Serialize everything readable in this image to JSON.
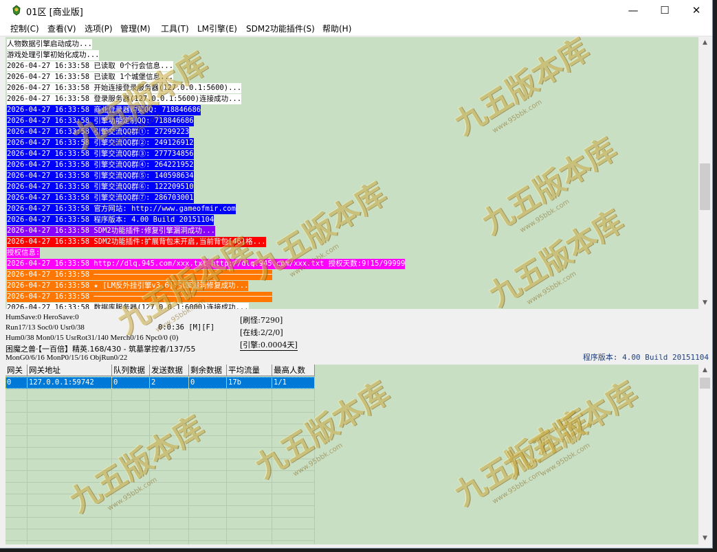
{
  "window": {
    "title": "01区 [商业版]",
    "minimize": "—",
    "maximize": "☐",
    "close": "✕"
  },
  "menu": [
    "控制(C)",
    "查看(V)",
    "选项(P)",
    "管理(M)",
    "工具(T)",
    "LM引擎(E)",
    "SDM2功能插件(S)",
    "帮助(H)"
  ],
  "log_lines": [
    {
      "text": "人物数据引擎启动成功...",
      "bg": "#ffffff",
      "fg": "#000000"
    },
    {
      "text": "游戏处理引擎初始化成功...",
      "bg": "#ffffff",
      "fg": "#000000"
    },
    {
      "text": "2026-04-27 16:33:58 已读取 0个行会信息...",
      "bg": "#ffffff",
      "fg": "#000000"
    },
    {
      "text": "2026-04-27 16:33:58 已读取 1个城堡信息...",
      "bg": "#ffffff",
      "fg": "#000000"
    },
    {
      "text": "2026-04-27 16:33:58 开始连接登录服务器(127.0.0.1:5600)...",
      "bg": "#ffffff",
      "fg": "#000000"
    },
    {
      "text": "2026-04-27 16:33:58 登录服务器(127.0.0.1:5600)连接成功...",
      "bg": "#ffffff",
      "fg": "#000000"
    },
    {
      "text": "2026-04-27 16:33:58 商业登录器购买QQ: 718846686",
      "bg": "#0000ff",
      "fg": "#ffffff"
    },
    {
      "text": "2026-04-27 16:33:58 引擎功能定制QQ: 718846686",
      "bg": "#0000ff",
      "fg": "#ffffff"
    },
    {
      "text": "2026-04-27 16:33:58 引擎交流QQ群①: 27299223",
      "bg": "#0000ff",
      "fg": "#ffffff"
    },
    {
      "text": "2026-04-27 16:33:58 引擎交流QQ群②: 249126912",
      "bg": "#0000ff",
      "fg": "#ffffff"
    },
    {
      "text": "2026-04-27 16:33:58 引擎交流QQ群③: 277734856",
      "bg": "#0000ff",
      "fg": "#ffffff"
    },
    {
      "text": "2026-04-27 16:33:58 引擎交流QQ群④: 264221952",
      "bg": "#0000ff",
      "fg": "#ffffff"
    },
    {
      "text": "2026-04-27 16:33:58 引擎交流QQ群⑤: 140598634",
      "bg": "#0000ff",
      "fg": "#ffffff"
    },
    {
      "text": "2026-04-27 16:33:58 引擎交流QQ群⑥: 122209510",
      "bg": "#0000ff",
      "fg": "#ffffff"
    },
    {
      "text": "2026-04-27 16:33:58 引擎交流QQ群⑦: 286703001",
      "bg": "#0000ff",
      "fg": "#ffffff"
    },
    {
      "text": "2026-04-27 16:33:58 官方网站: http://www.gameofmir.com",
      "bg": "#0000ff",
      "fg": "#ffffff"
    },
    {
      "text": "2026-04-27 16:33:58 程序版本: 4.00 Build 20151104",
      "bg": "#0000ff",
      "fg": "#ffffff"
    },
    {
      "text": "2026-04-27 16:33:58 SDM2功能插件:修复引擎漏洞成功...",
      "bg": "#8a00ff",
      "fg": "#ffffff"
    },
    {
      "text": "2026-04-27 16:33:58 SDM2功能插件:扩展背包未开启,当前背包[46]格...",
      "bg": "#ff0000",
      "fg": "#ffffff"
    },
    {
      "text": "授权信息:",
      "bg": "#ff00ff",
      "fg": "#ffffff"
    },
    {
      "text": "2026-04-27 16:33:58 http://dlq.945.com/xxx.txt http://dlq.945.com/xxx.txt 授权天数:9ǀ15/99999",
      "bg": "#ff00ff",
      "fg": "#ffffff"
    },
    {
      "text": "2026-04-27 16:33:58 ─────────────────────────────────────────",
      "bg": "#ff7700",
      "fg": "#ffffff"
    },
    {
      "text": "2026-04-27 16:33:58 ★ [LM反外挂引擎v3.6]:引擎漏洞修复成功...",
      "bg": "#ff7700",
      "fg": "#ffffff"
    },
    {
      "text": "2026-04-27 16:33:58 ─────────────────────────────────────────",
      "bg": "#ff7700",
      "fg": "#ffffff"
    },
    {
      "text": "2026-04-27 16:33:58 数据库服务器(127.0.0.1:6000)连接成功...",
      "bg": "#ffffff",
      "fg": "#000000"
    }
  ],
  "status": {
    "line1": "HumSave:0 HeroSave:0",
    "line2": "Run17/13 Soc0/0 Usr0/38",
    "timer": "0:0:36 [M][F]",
    "line3": "Hum0/38 Mon0/15 UsrRot31/140 Merch0/16 Npc0/0 (0)",
    "line4": "困魔之兽·【一百倍】精英.168/430 - 筑墓掌控者/137/55",
    "line5": "MonG0/6/16 MonP0/15/16 ObjRun0/22",
    "refresh": "[刷怪:7290]",
    "online": "[在线:2/2/0]",
    "engine": "[引擎:0.0004天]",
    "version": "程序版本: 4.00 Build 20151104"
  },
  "grid": {
    "headers": [
      "网关",
      "网关地址",
      "队列数据",
      "发送数据",
      "剩余数据",
      "平均流量",
      "最高人数"
    ],
    "rows": [
      [
        "0",
        "127.0.0.1:59742",
        "0",
        "2",
        "0",
        "17b",
        "1/1"
      ]
    ],
    "row_selected_color": "#0078d7"
  },
  "watermark": {
    "text": "九五版本库",
    "sub": "www.95bbk.com"
  }
}
